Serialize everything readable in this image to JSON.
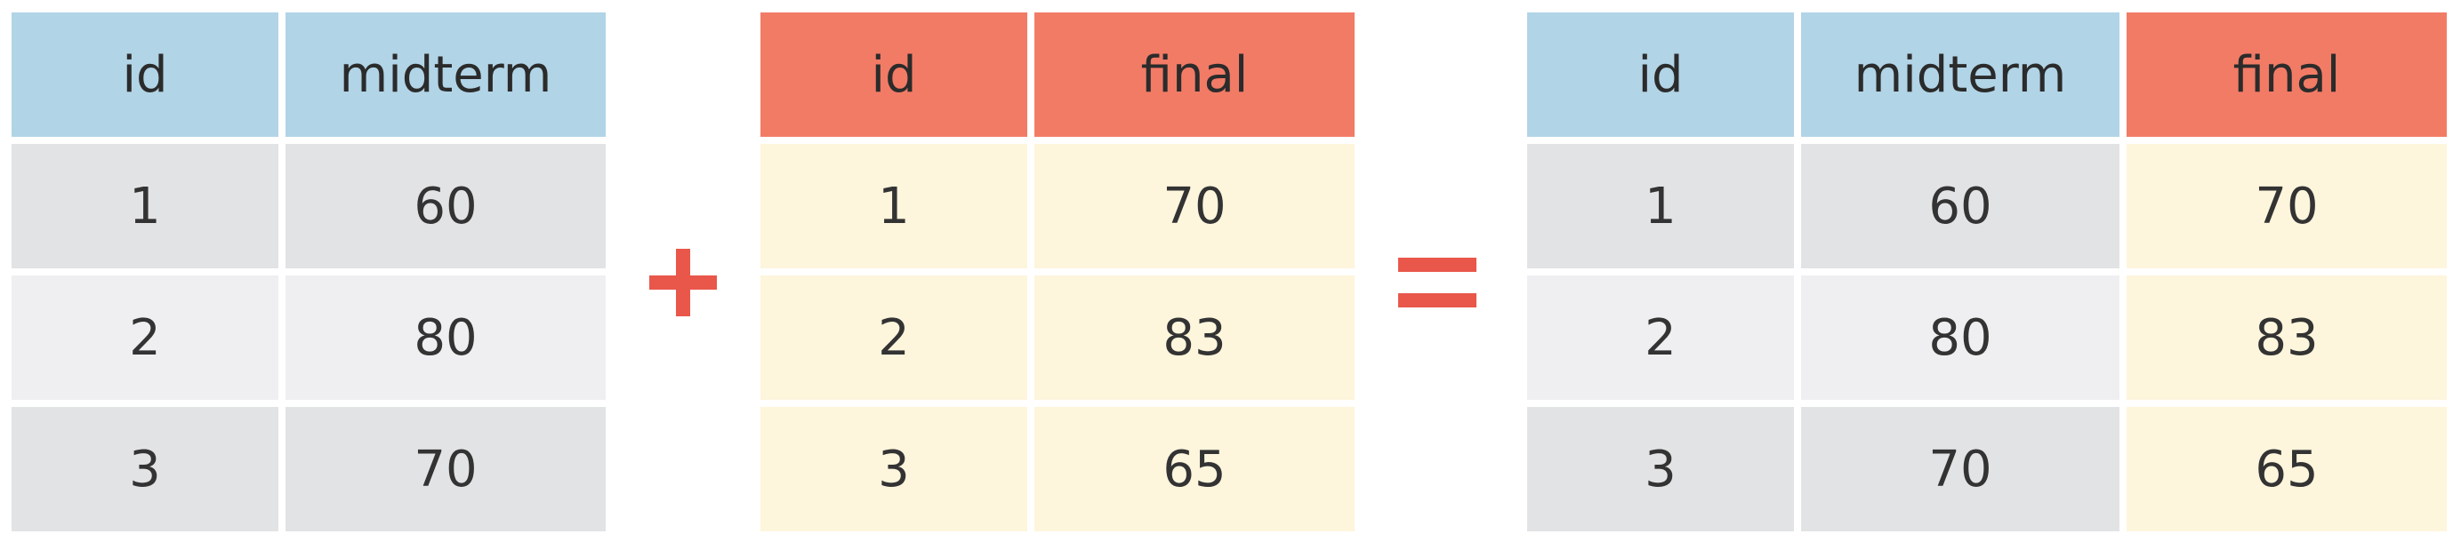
{
  "left_table": {
    "headers": [
      "id",
      "midterm"
    ],
    "rows": [
      [
        "1",
        "60"
      ],
      [
        "2",
        "80"
      ],
      [
        "3",
        "70"
      ]
    ]
  },
  "right_operand_table": {
    "headers": [
      "id",
      "final"
    ],
    "rows": [
      [
        "1",
        "70"
      ],
      [
        "2",
        "83"
      ],
      [
        "3",
        "65"
      ]
    ]
  },
  "result_table": {
    "headers": [
      "id",
      "midterm",
      "final"
    ],
    "rows": [
      [
        "1",
        "60",
        "70"
      ],
      [
        "2",
        "80",
        "83"
      ],
      [
        "3",
        "70",
        "65"
      ]
    ]
  },
  "operators": {
    "plus_icon": "plus-icon",
    "equals_icon": "equals-icon"
  },
  "colors": {
    "blue_header": "#b1d4e6",
    "red_header": "#f27b66",
    "operator": "#e8574a",
    "gray_dark": "#e2e3e5",
    "gray_light": "#efeff2",
    "cream": "#fdf5dc"
  }
}
